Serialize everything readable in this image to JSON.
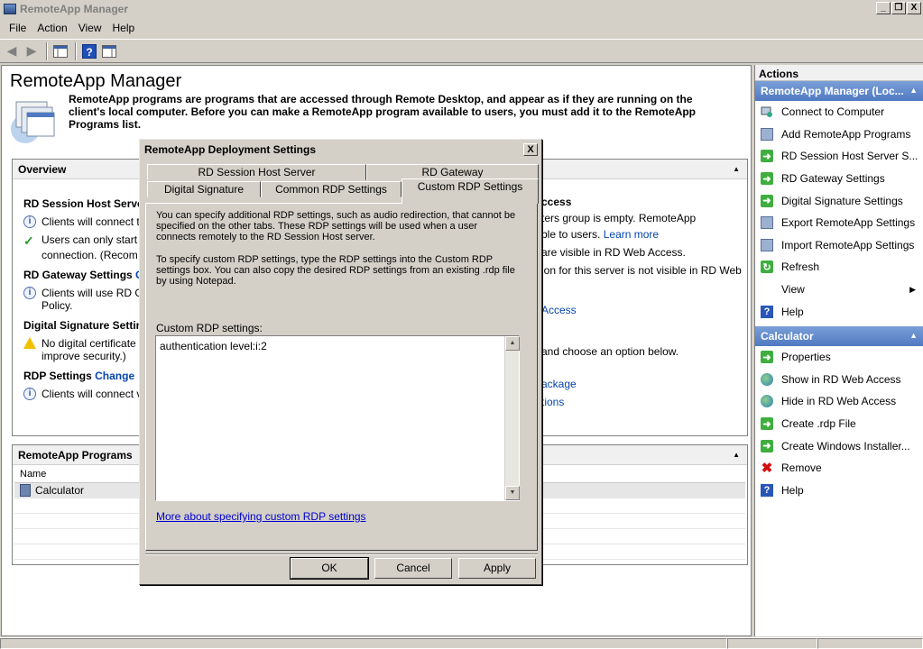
{
  "window": {
    "title": "RemoteApp Manager",
    "minimize": "_",
    "restore": "❐",
    "close": "X"
  },
  "menu": [
    "File",
    "Action",
    "View",
    "Help"
  ],
  "toolbar": {
    "icons": [
      "back-icon",
      "forward-icon",
      "show-hide-tree-icon",
      "help-icon",
      "show-hide-action-pane-icon"
    ],
    "help_glyph": "?"
  },
  "main": {
    "title": "RemoteApp Manager",
    "intro": "RemoteApp programs are programs that are accessed through Remote Desktop, and appear as if they are running on the client's local computer. Before you can make a RemoteApp program available to users, you must add it to the RemoteApp Programs list.",
    "overview": {
      "header": "Overview",
      "rd_session_host": {
        "title": "RD Session Host Server",
        "lines": [
          "Clients will connect t",
          "Users can only start l",
          "connection. (Recom"
        ]
      },
      "rd_gateway": {
        "title": "RD Gateway Settings",
        "link": "C",
        "lines": [
          "Clients will use RD G",
          "Policy."
        ]
      },
      "digital_signature": {
        "title": "Digital Signature Settin",
        "lines": [
          "No digital certificate",
          "improve security.)"
        ]
      },
      "rdp_settings": {
        "title": "RDP Settings",
        "link": "Change",
        "lines": [
          "Clients will connect v"
        ]
      },
      "right_fragments": [
        "ccess",
        "ters group is empty. RemoteApp",
        "ble to users.",
        "Learn more",
        "are visible in RD Web Access.",
        "ion for this server is not visible in RD Web",
        "Access",
        "and choose an option below.",
        "ackage",
        "tions"
      ]
    },
    "programs": {
      "header": "RemoteApp Programs",
      "column": "Name",
      "rows": [
        "Calculator"
      ]
    }
  },
  "actions": {
    "title": "Actions",
    "group1": {
      "title": "RemoteApp Manager (Loc...",
      "items": [
        {
          "label": "Connect to Computer",
          "icon": "connect-computer-icon"
        },
        {
          "label": "Add RemoteApp Programs",
          "icon": "add-program-icon"
        },
        {
          "label": "RD Session Host Server S...",
          "icon": "green-arrow-icon"
        },
        {
          "label": "RD Gateway Settings",
          "icon": "green-arrow-icon"
        },
        {
          "label": "Digital Signature Settings",
          "icon": "green-arrow-icon"
        },
        {
          "label": "Export RemoteApp Settings",
          "icon": "export-icon"
        },
        {
          "label": "Import RemoteApp Settings",
          "icon": "import-icon"
        },
        {
          "label": "Refresh",
          "icon": "refresh-icon"
        },
        {
          "label": "View",
          "icon": "none"
        },
        {
          "label": "Help",
          "icon": "help-icon"
        }
      ]
    },
    "group2": {
      "title": "Calculator",
      "items": [
        {
          "label": "Properties",
          "icon": "green-arrow-icon"
        },
        {
          "label": "Show in RD Web Access",
          "icon": "globe-icon"
        },
        {
          "label": "Hide in RD Web Access",
          "icon": "globe-icon"
        },
        {
          "label": "Create .rdp File",
          "icon": "green-arrow-icon"
        },
        {
          "label": "Create Windows Installer...",
          "icon": "green-arrow-icon"
        },
        {
          "label": "Remove",
          "icon": "remove-icon"
        },
        {
          "label": "Help",
          "icon": "help-icon"
        }
      ]
    }
  },
  "dialog": {
    "title": "RemoteApp Deployment Settings",
    "close": "X",
    "tabs_back": [
      "RD Session Host Server",
      "RD Gateway"
    ],
    "tabs_front": [
      "Digital Signature",
      "Common RDP Settings",
      "Custom RDP Settings"
    ],
    "active_tab": "Custom RDP Settings",
    "para1": "You can specify additional RDP settings, such as audio redirection, that cannot be specified on the other tabs.  These RDP settings will be used when a user connects remotely to the RD Session Host server.",
    "para2": "To specify custom RDP settings, type the RDP settings into the Custom RDP settings box.  You can also copy the desired RDP settings from an existing .rdp file by using Notepad.",
    "field_label": "Custom RDP settings:",
    "field_value": "authentication level:i:2",
    "link": "More about specifying custom RDP settings",
    "buttons": {
      "ok": "OK",
      "cancel": "Cancel",
      "apply": "Apply"
    }
  }
}
